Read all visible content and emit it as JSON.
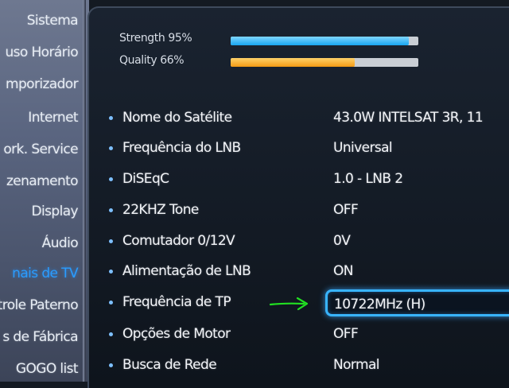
{
  "sidebar": {
    "items": [
      {
        "label": "Sistema"
      },
      {
        "label": "uso Horário"
      },
      {
        "label": "mporizador"
      },
      {
        "label": "Internet"
      },
      {
        "label": "ork. Service"
      },
      {
        "label": "zenamento"
      },
      {
        "label": "Display"
      },
      {
        "label": "Áudio"
      },
      {
        "label": "nais de TV"
      },
      {
        "label": "trole Paterno"
      },
      {
        "label": "s de Fábrica"
      },
      {
        "label": "GOGO list"
      }
    ],
    "active_index": 8,
    "active_color": "#2a9cff"
  },
  "signal": {
    "strength_label": "Strength 95%",
    "strength_value": 95,
    "quality_label": "Quality 66%",
    "quality_value": 66,
    "strength_color": "#18a6f0",
    "quality_color": "#f39a14"
  },
  "settings": [
    {
      "label": "Nome do Satélite",
      "value": "43.0W INTELSAT 3R, 11"
    },
    {
      "label": "Frequência do LNB",
      "value": "Universal"
    },
    {
      "label": "DiSEqC",
      "value": "1.0 - LNB 2"
    },
    {
      "label": "22KHZ Tone",
      "value": "OFF"
    },
    {
      "label": "Comutador 0/12V",
      "value": "0V"
    },
    {
      "label": "Alimentação de LNB",
      "value": "ON"
    },
    {
      "label": "Frequência de TP",
      "value": "10722MHz (H)"
    },
    {
      "label": "Opções de Motor",
      "value": "OFF"
    },
    {
      "label": "Busca de Rede",
      "value": "Normal"
    }
  ],
  "selected_index": 6,
  "annotation": {
    "icon": "green-arrow-icon",
    "color": "#22e022"
  }
}
